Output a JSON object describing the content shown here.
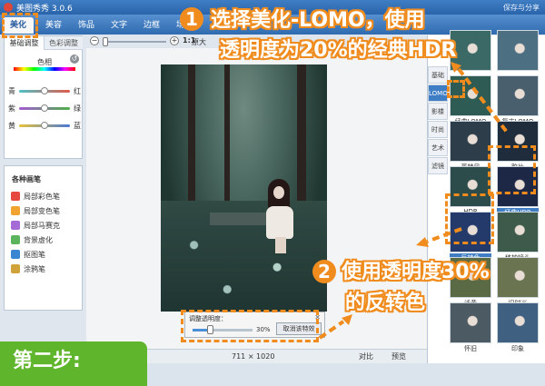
{
  "window": {
    "title": "美图秀秀 3.0.6",
    "save_share": "保存与分享"
  },
  "menu": {
    "tabs": [
      "美化",
      "美容",
      "饰品",
      "文字",
      "边框",
      "场景"
    ],
    "active": "美化"
  },
  "adjust": {
    "tabs": [
      "基础调整",
      "色彩调整"
    ],
    "hue_label": "色相",
    "sliders": [
      {
        "left": "青",
        "right": "红",
        "color": "#e05a4a"
      },
      {
        "left": "紫",
        "right": "绿",
        "color": "#4fb04a"
      },
      {
        "left": "黄",
        "right": "蓝",
        "color": "#4a79d6"
      }
    ]
  },
  "brushes": {
    "title": "各种画笔",
    "items": [
      {
        "label": "局部彩色笔",
        "color": "#e6473e"
      },
      {
        "label": "局部变色笔",
        "color": "#f0a32e"
      },
      {
        "label": "局部马赛克",
        "color": "#a66ad6"
      },
      {
        "label": "背景虚化",
        "color": "#5bb35b"
      },
      {
        "label": "抠图笔",
        "color": "#3a86d0"
      },
      {
        "label": "涂鸦笔",
        "color": "#d0a23a"
      }
    ]
  },
  "zoom": {
    "minus": "−",
    "plus": "+",
    "one_to_one": "1:1",
    "original": "原大"
  },
  "opacity_dialog": {
    "label": "调整透明度：",
    "value": "30%",
    "level": 0.3,
    "undo": "取消该特效",
    "close": "✕"
  },
  "status": {
    "dimensions": "711 × 1020",
    "compare": "对比",
    "preview": "预览"
  },
  "effects": {
    "categories": [
      "基础",
      "LOMO",
      "影楼",
      "时尚",
      "艺术",
      "滤镜"
    ],
    "active_category": "LOMO",
    "items": [
      {
        "label": "",
        "tint": "#3b6a66"
      },
      {
        "label": "",
        "tint": "#4c6f82"
      },
      {
        "label": "经典LOMO",
        "tint": "#2f5b55"
      },
      {
        "label": "复古LOMO",
        "tint": "#4a5f6e"
      },
      {
        "label": "哥特风",
        "tint": "#2d3e4a"
      },
      {
        "label": "胶片",
        "tint": "#1e2c3c"
      },
      {
        "label": "HDR",
        "tint": "#2b4c4a"
      },
      {
        "label": "经典HDR",
        "tint": "#1c2846"
      },
      {
        "label": "反转色",
        "tint": "#233a6a"
      },
      {
        "label": "移轴镜头",
        "tint": "#3e5a4a"
      },
      {
        "label": "泛黄",
        "tint": "#5a6a44"
      },
      {
        "label": "旧时光",
        "tint": "#6a7450"
      },
      {
        "label": "怀旧",
        "tint": "#4b5a63"
      },
      {
        "label": "印象",
        "tint": "#3f6080"
      }
    ],
    "selected": [
      "经典HDR",
      "反转色"
    ]
  },
  "annotations": {
    "badge_1": "1",
    "badge_2": "2",
    "text_1_line1": "选择美化-LOMO，使用",
    "text_1_line2": "透明度为20%的经典HDR",
    "text_2_line1": "使用透明度30%",
    "text_2_line2": "的反转色",
    "step": "第二步:"
  }
}
